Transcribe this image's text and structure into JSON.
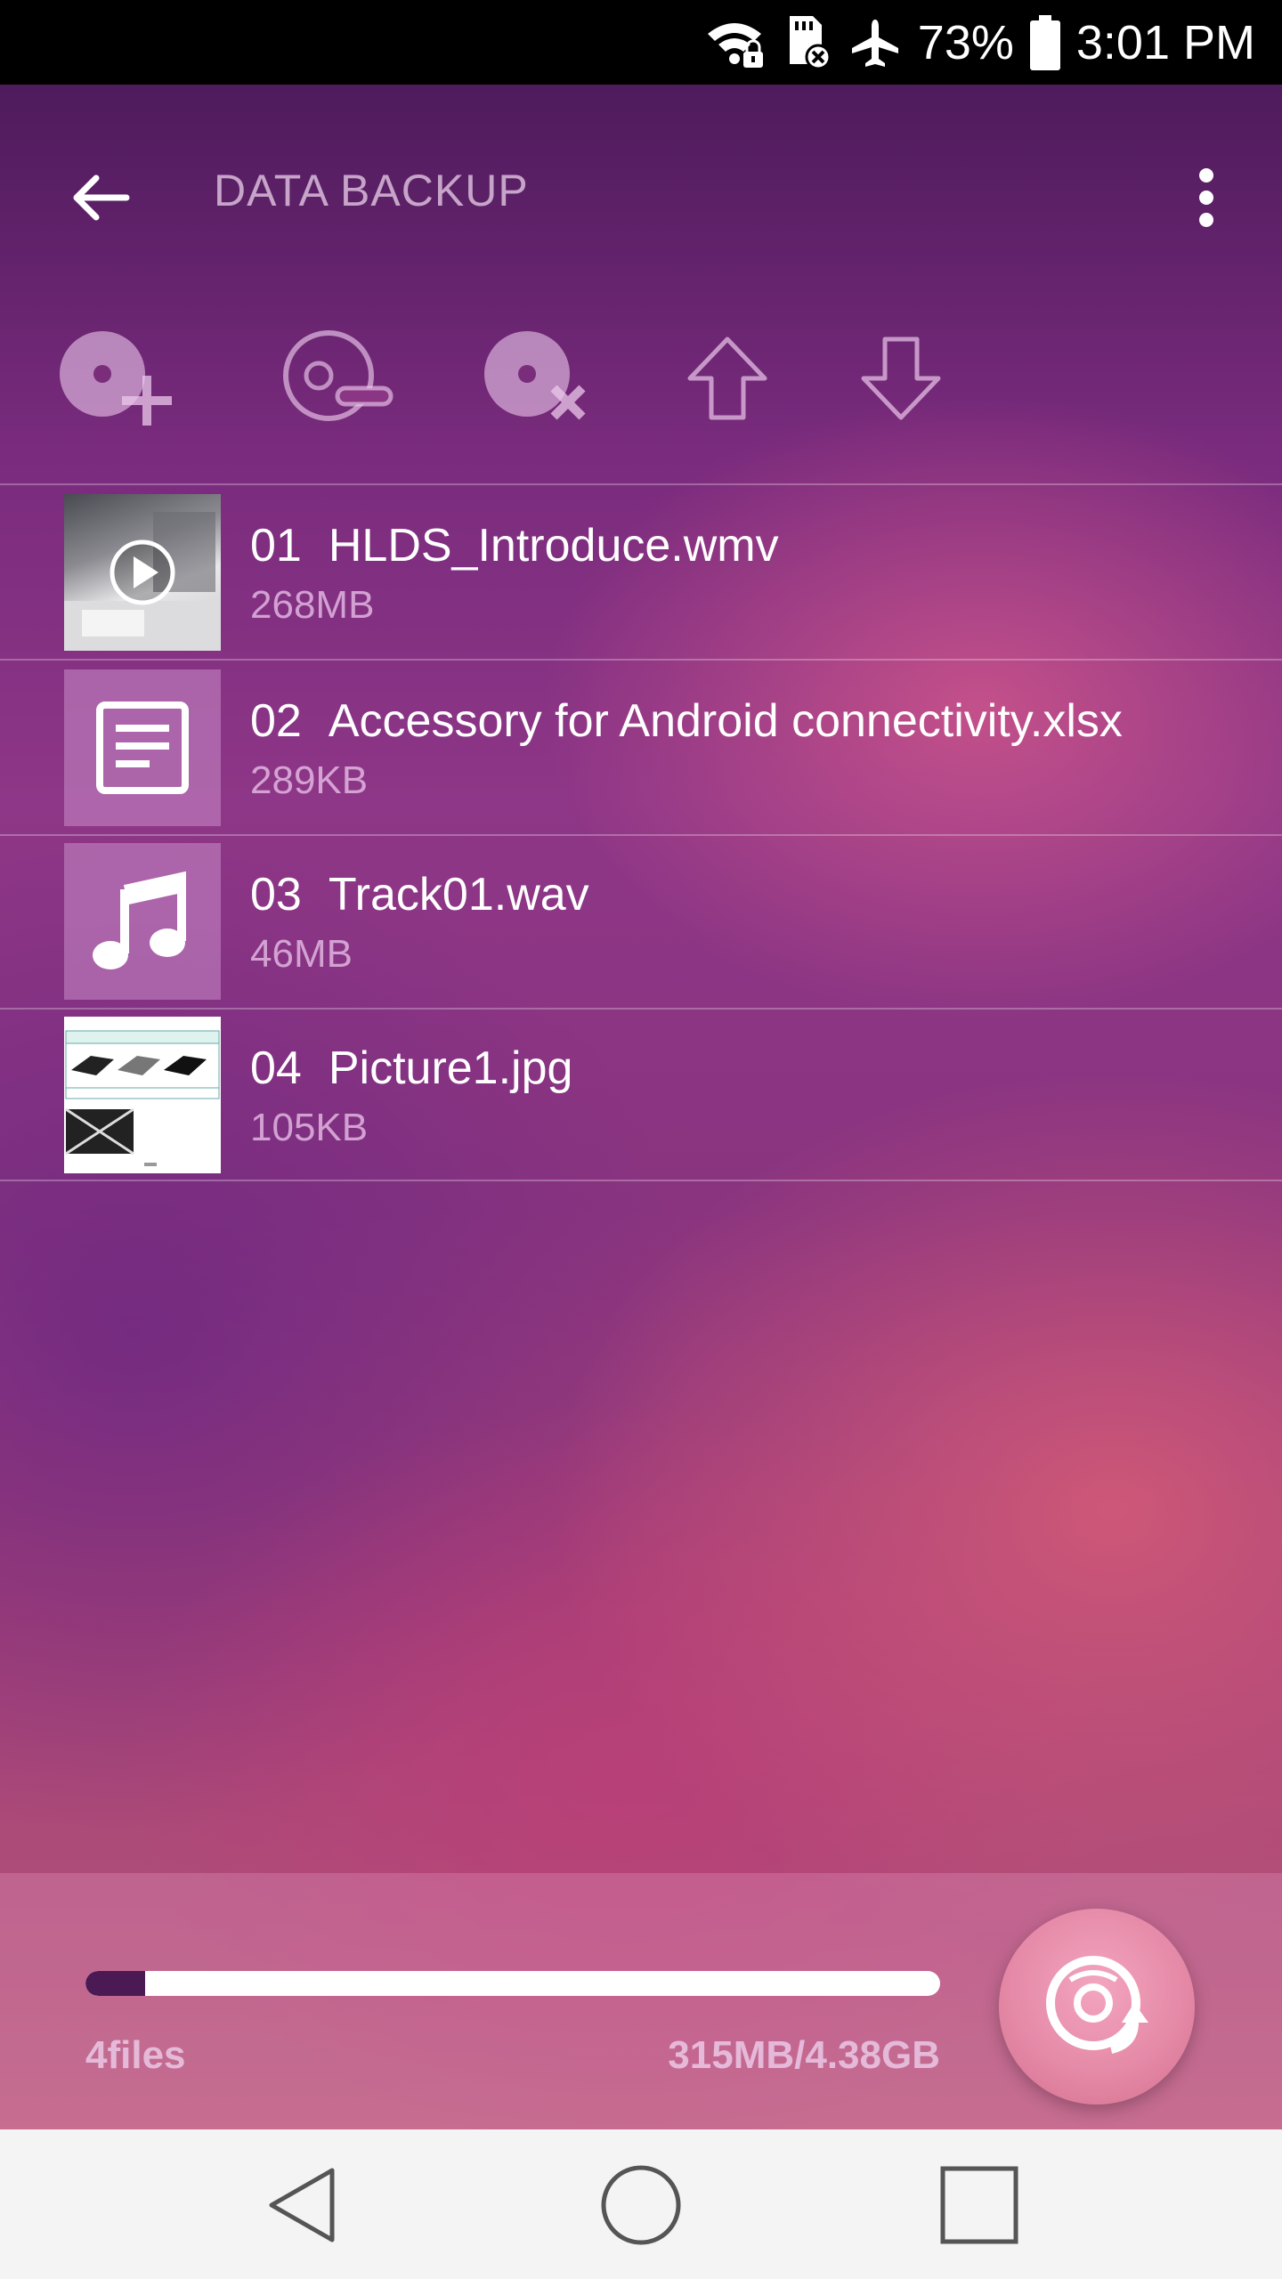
{
  "status_bar": {
    "battery": "73%",
    "time": "3:01 PM",
    "icons": [
      "wifi-lock-icon",
      "sd-card-error-icon",
      "airplane-mode-icon",
      "battery-icon"
    ]
  },
  "app_bar": {
    "title": "DATA BACKUP",
    "back_icon": "arrow-left-icon",
    "menu_icon": "more-vert-icon"
  },
  "toolbar": {
    "buttons": [
      {
        "name": "add-disc-button",
        "icon": "disc-add-icon"
      },
      {
        "name": "remove-disc-button",
        "icon": "disc-minus-icon"
      },
      {
        "name": "delete-disc-button",
        "icon": "disc-close-icon"
      },
      {
        "name": "move-up-button",
        "icon": "arrow-up-icon"
      },
      {
        "name": "move-down-button",
        "icon": "arrow-down-icon"
      }
    ]
  },
  "files": [
    {
      "num": "01",
      "name": "HLDS_Introduce.wmv",
      "size": "268MB",
      "type": "video"
    },
    {
      "num": "02",
      "name": "Accessory for Android connectivity.xlsx",
      "size": "289KB",
      "type": "document"
    },
    {
      "num": "03",
      "name": "Track01.wav",
      "size": "46MB",
      "type": "audio"
    },
    {
      "num": "04",
      "name": "Picture1.jpg",
      "size": "105KB",
      "type": "image"
    }
  ],
  "footer": {
    "files_count": "4files",
    "storage": "315MB/4.38GB",
    "progress": 0.07,
    "fab_icon": "disc-burn-icon"
  },
  "nav_bar": {
    "icons": [
      "nav-back-icon",
      "nav-home-icon",
      "nav-recents-icon"
    ]
  },
  "colors": {
    "accent_dark": "#4b1a55",
    "fab": "#e58aa8",
    "nav_bg": "#f4f4f4"
  }
}
